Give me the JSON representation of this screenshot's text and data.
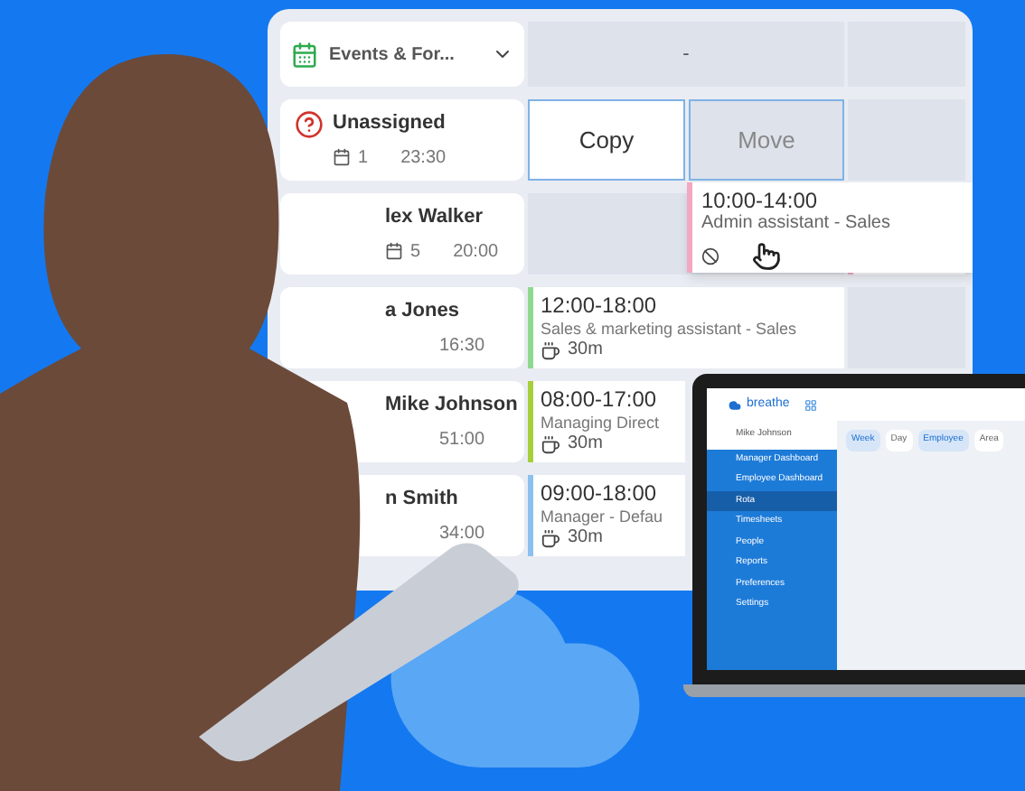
{
  "roster": {
    "filter": {
      "label": "Events & For..."
    },
    "header_cell": "-",
    "actions": [
      {
        "label": "Copy",
        "selected": true
      },
      {
        "label": "Move",
        "selected": false
      }
    ],
    "employees": [
      {
        "kind": "unassigned",
        "name": "Unassigned",
        "count": "1",
        "hours": "23:30"
      },
      {
        "kind": "person",
        "name": "lex Walker",
        "count": "5",
        "hours": "20:00"
      },
      {
        "kind": "person",
        "name": "a Jones",
        "hours": "16:30"
      },
      {
        "kind": "person",
        "name": "Mike Johnson",
        "hours": "51:00"
      },
      {
        "kind": "person",
        "name": "n Smith",
        "hours": "34:00"
      }
    ],
    "dragged_shift": {
      "time": "10:00-14:00",
      "role": "Admin assistant - Sales",
      "color": "#f4a7c0"
    },
    "shifts": [
      {
        "time": "12:00-18:00",
        "role": "Sales & marketing assistant - Sales",
        "break": "30m",
        "color": "#8fd98f"
      },
      {
        "time": "08:00-17:00",
        "role": "Managing Direct",
        "break": "30m",
        "color": "#a6cf3b"
      },
      {
        "time": "09:00-18:00",
        "role": "Manager - Defau",
        "break": "30m",
        "color": "#8cc0f0"
      }
    ]
  },
  "laptop": {
    "logo": "breathe",
    "user": "Mike Johnson",
    "nav": [
      {
        "label": "Manager Dashboard",
        "selected": false
      },
      {
        "label": "Employee Dashboard",
        "selected": false
      },
      {
        "label": "Rota",
        "selected": true
      },
      {
        "label": "Timesheets",
        "selected": false
      },
      {
        "label": "People",
        "selected": false
      },
      {
        "label": "Reports",
        "selected": false
      },
      {
        "label": "Preferences",
        "selected": false
      },
      {
        "label": "Settings",
        "selected": false
      }
    ],
    "views": [
      {
        "label": "Week",
        "selected": true
      },
      {
        "label": "Day",
        "selected": false
      },
      {
        "label": "Employee",
        "selected": true
      },
      {
        "label": "Area",
        "selected": false
      }
    ]
  }
}
